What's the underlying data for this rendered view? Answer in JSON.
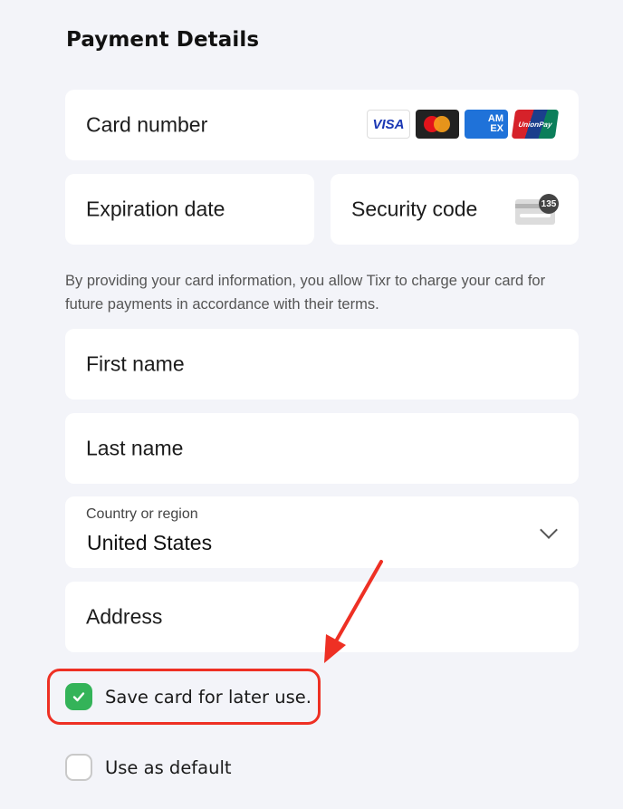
{
  "page": {
    "title": "Payment Details"
  },
  "card": {
    "card_number_placeholder": "Card number",
    "brands": [
      {
        "name": "visa",
        "label": "VISA"
      },
      {
        "name": "mastercard",
        "label": ""
      },
      {
        "name": "amex",
        "label_line1": "AM",
        "label_line2": "EX"
      },
      {
        "name": "unionpay",
        "label": "UnionPay"
      }
    ],
    "expiration_placeholder": "Expiration date",
    "security_code_placeholder": "Security code",
    "security_code_hint": "135"
  },
  "notice": "By providing your card information, you allow Tixr to charge your card for future payments in accordance with their terms.",
  "billing": {
    "first_name_placeholder": "First name",
    "last_name_placeholder": "Last name",
    "country_label": "Country or region",
    "country_value": "United States",
    "address_placeholder": "Address"
  },
  "options": {
    "save_card_label": "Save card for later use.",
    "save_card_checked": true,
    "use_default_label": "Use as default",
    "use_default_checked": false
  },
  "annotation": {
    "color": "#ee3024",
    "target": "save-card-checkbox"
  },
  "colors": {
    "background": "#f3f4f9",
    "checkbox_checked": "#34b359"
  }
}
